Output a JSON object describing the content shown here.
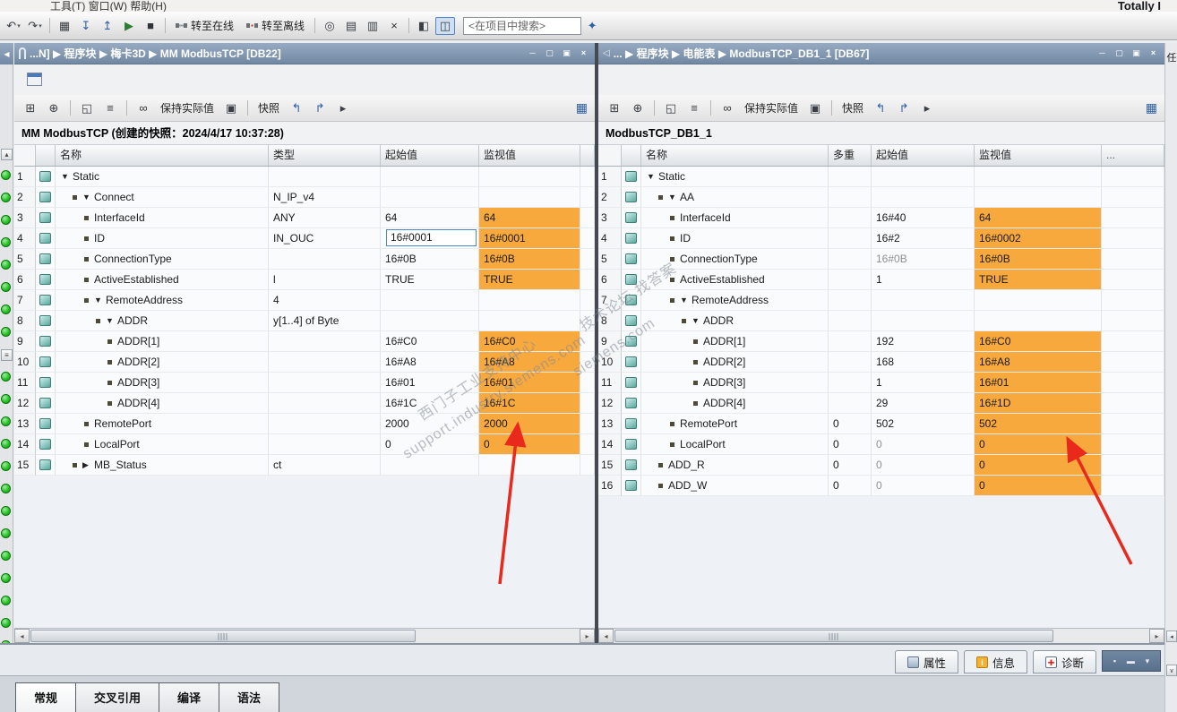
{
  "chrome": {
    "menu_fragment": "工具(T)    窗口(W)    帮助(H)",
    "brand_fragment": "Totally I",
    "go_online_label": "转至在线",
    "go_offline_label": "转至离线",
    "search_text": "<在项目中搜索>"
  },
  "panels": [
    {
      "title": "...N]  ▶  程序块  ▶  梅卡3D  ▶  MM ModbusTCP [DB22]",
      "doc_title": "MM ModbusTCP (创建的快照：2024/4/17 10:37:28)",
      "toolbar": {
        "keep_actual_label": "保持实际值",
        "snapshot_label": "快照"
      },
      "columns": {
        "name": "名称",
        "type": "类型",
        "start": "起始值",
        "monitor": "监视值"
      },
      "rows": [
        {
          "n": 1,
          "lvl": 0,
          "exp": "▼",
          "name": "Static"
        },
        {
          "n": 2,
          "lvl": 1,
          "bullet": true,
          "exp": "▼",
          "name": "Connect",
          "type": "N_IP_v4"
        },
        {
          "n": 3,
          "lvl": 2,
          "bullet": true,
          "name": "InterfaceId",
          "type": "ANY",
          "start": "64",
          "mon": "64",
          "hl": true
        },
        {
          "n": 4,
          "lvl": 2,
          "bullet": true,
          "name": "ID",
          "type": "IN_OUC",
          "start": "16#0001",
          "sedit": true,
          "mon": "16#0001",
          "hl": true
        },
        {
          "n": 5,
          "lvl": 2,
          "bullet": true,
          "name": "ConnectionType",
          "start": "16#0B",
          "mon": "16#0B",
          "hl": true
        },
        {
          "n": 6,
          "lvl": 2,
          "bullet": true,
          "name": "ActiveEstablished",
          "type": "l",
          "start": "TRUE",
          "mon": "TRUE",
          "hl": true
        },
        {
          "n": 7,
          "lvl": 2,
          "bullet": true,
          "exp": "▼",
          "name": "RemoteAddress",
          "type": "4"
        },
        {
          "n": 8,
          "lvl": 3,
          "bullet": true,
          "exp": "▼",
          "name": "ADDR",
          "type": "y[1..4] of Byte"
        },
        {
          "n": 9,
          "lvl": 4,
          "bullet": true,
          "name": "ADDR[1]",
          "start": "16#C0",
          "mon": "16#C0",
          "hl": true
        },
        {
          "n": 10,
          "lvl": 4,
          "bullet": true,
          "name": "ADDR[2]",
          "start": "16#A8",
          "mon": "16#A8",
          "hl": true
        },
        {
          "n": 11,
          "lvl": 4,
          "bullet": true,
          "name": "ADDR[3]",
          "start": "16#01",
          "mon": "16#01",
          "hl": true
        },
        {
          "n": 12,
          "lvl": 4,
          "bullet": true,
          "name": "ADDR[4]",
          "start": "16#1C",
          "mon": "16#1C",
          "hl": true
        },
        {
          "n": 13,
          "lvl": 2,
          "bullet": true,
          "name": "RemotePort",
          "start": "2000",
          "mon": "2000",
          "hl": true
        },
        {
          "n": 14,
          "lvl": 2,
          "bullet": true,
          "name": "LocalPort",
          "start": "0",
          "mon": "0",
          "hl": true
        },
        {
          "n": 15,
          "lvl": 1,
          "bullet": true,
          "exp": "▶",
          "name": "MB_Status",
          "type": "ct"
        }
      ]
    },
    {
      "title": "...  ▶  程序块  ▶  电能表  ▶  ModbusTCP_DB1_1 [DB67]",
      "doc_title": "ModbusTCP_DB1_1",
      "toolbar": {
        "keep_actual_label": "保持实际值",
        "snapshot_label": "快照"
      },
      "columns": {
        "name": "名称",
        "multi": "多重",
        "start": "起始值",
        "monitor": "监视值",
        "more": "..."
      },
      "rows": [
        {
          "n": 1,
          "lvl": 0,
          "exp": "▼",
          "name": "Static"
        },
        {
          "n": 2,
          "lvl": 1,
          "bullet": true,
          "exp": "▼",
          "name": "AA"
        },
        {
          "n": 3,
          "lvl": 2,
          "bullet": true,
          "name": "InterfaceId",
          "start": "16#40",
          "mon": "64",
          "hl": true
        },
        {
          "n": 4,
          "lvl": 2,
          "bullet": true,
          "name": "ID",
          "start": "16#2",
          "mon": "16#0002",
          "hl": true
        },
        {
          "n": 5,
          "lvl": 2,
          "bullet": true,
          "name": "ConnectionType",
          "start": "16#0B",
          "sgray": true,
          "mon": "16#0B",
          "hl": true
        },
        {
          "n": 6,
          "lvl": 2,
          "bullet": true,
          "name": "ActiveEstablished",
          "start": "1",
          "mon": "TRUE",
          "hl": true
        },
        {
          "n": 7,
          "lvl": 2,
          "bullet": true,
          "exp": "▼",
          "name": "RemoteAddress"
        },
        {
          "n": 8,
          "lvl": 3,
          "bullet": true,
          "exp": "▼",
          "name": "ADDR"
        },
        {
          "n": 9,
          "lvl": 4,
          "bullet": true,
          "name": "ADDR[1]",
          "start": "192",
          "mon": "16#C0",
          "hl": true
        },
        {
          "n": 10,
          "lvl": 4,
          "bullet": true,
          "name": "ADDR[2]",
          "start": "168",
          "mon": "16#A8",
          "hl": true
        },
        {
          "n": 11,
          "lvl": 4,
          "bullet": true,
          "name": "ADDR[3]",
          "start": "1",
          "mon": "16#01",
          "hl": true
        },
        {
          "n": 12,
          "lvl": 4,
          "bullet": true,
          "name": "ADDR[4]",
          "start": "29",
          "mon": "16#1D",
          "hl": true
        },
        {
          "n": 13,
          "lvl": 2,
          "bullet": true,
          "name": "RemotePort",
          "multi": "0",
          "start": "502",
          "mon": "502",
          "hl": true
        },
        {
          "n": 14,
          "lvl": 2,
          "bullet": true,
          "name": "LocalPort",
          "multi": "0",
          "start": "0",
          "sgray": true,
          "mon": "0",
          "hl": true
        },
        {
          "n": 15,
          "lvl": 1,
          "bullet": true,
          "name": "ADD_R",
          "multi": "0",
          "start": "0",
          "sgray": true,
          "mon": "0",
          "hl": true
        },
        {
          "n": 16,
          "lvl": 1,
          "bullet": true,
          "name": "ADD_W",
          "multi": "0",
          "start": "0",
          "sgray": true,
          "mon": "0",
          "hl": true
        }
      ]
    }
  ],
  "inspector": {
    "tabs": [
      {
        "label": "属性"
      },
      {
        "label": "信息"
      },
      {
        "label": "诊断"
      }
    ]
  },
  "bottom_tabs": [
    {
      "label": "常规"
    },
    {
      "label": "交叉引用"
    },
    {
      "label": "编译"
    },
    {
      "label": "语法"
    }
  ],
  "right_strip": {
    "task_label": "任"
  },
  "watermarks": [
    "西门子工业支持中心",
    "support.industry.siemens.com",
    "技术论坛 找答案",
    "siemens.com"
  ],
  "colors": {
    "monitor_highlight": "#F8A93E",
    "titlebar": "#8095AD",
    "annotation_arrow": "#E8291C",
    "status_dot": "#2CC22C"
  }
}
